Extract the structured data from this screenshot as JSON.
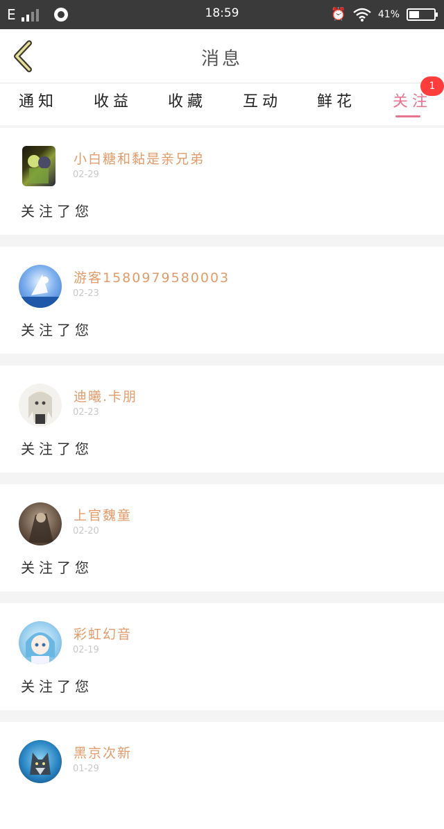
{
  "status_bar": {
    "network": "E",
    "time": "18:59",
    "battery_percent_text": "41%",
    "battery_level": 0.41,
    "icons": [
      "signal-icon",
      "app-icon",
      "alarm-icon",
      "wifi-icon",
      "battery-icon"
    ]
  },
  "header": {
    "title": "消息",
    "back_icon": "chevron-left-icon",
    "accent_color": "#e8758f"
  },
  "tabs": [
    {
      "label": "通知",
      "active": false
    },
    {
      "label": "收益",
      "active": false
    },
    {
      "label": "收藏",
      "active": false
    },
    {
      "label": "互动",
      "active": false
    },
    {
      "label": "鲜花",
      "active": false
    },
    {
      "label": "关注",
      "active": true,
      "badge": "1"
    }
  ],
  "messages": [
    {
      "name": "小白糖和黏是亲兄弟",
      "date": "02-29",
      "text": "关注了您"
    },
    {
      "name": "游客1580979580003",
      "date": "02-23",
      "text": "关注了您"
    },
    {
      "name": "迪曦.卡朋",
      "date": "02-23",
      "text": "关注了您"
    },
    {
      "name": "上官魏童",
      "date": "02-20",
      "text": "关注了您"
    },
    {
      "name": "彩虹幻音",
      "date": "02-19",
      "text": "关注了您"
    },
    {
      "name": "黑京次新",
      "date": "01-29",
      "text": ""
    }
  ]
}
